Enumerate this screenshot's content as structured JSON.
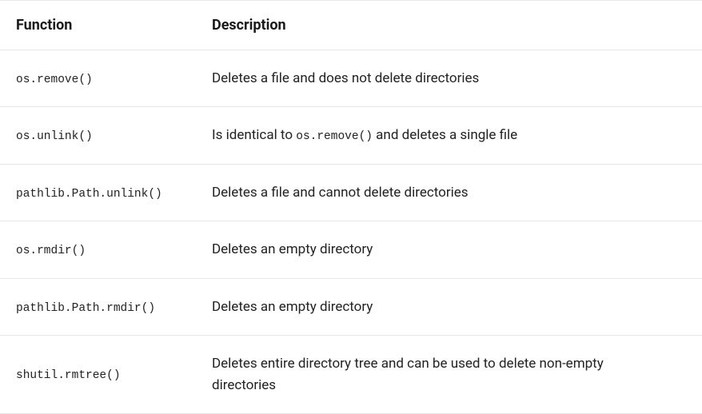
{
  "table": {
    "headers": {
      "function": "Function",
      "description": "Description"
    },
    "rows": [
      {
        "func": "os.remove()",
        "desc_before": "Deletes a file and does not delete directories",
        "desc_code": "",
        "desc_after": ""
      },
      {
        "func": "os.unlink()",
        "desc_before": "Is identical to ",
        "desc_code": "os.remove()",
        "desc_after": " and deletes a single file"
      },
      {
        "func": "pathlib.Path.unlink()",
        "desc_before": "Deletes a file and cannot delete directories",
        "desc_code": "",
        "desc_after": ""
      },
      {
        "func": "os.rmdir()",
        "desc_before": "Deletes an empty directory",
        "desc_code": "",
        "desc_after": ""
      },
      {
        "func": "pathlib.Path.rmdir()",
        "desc_before": "Deletes an empty directory",
        "desc_code": "",
        "desc_after": ""
      },
      {
        "func": "shutil.rmtree()",
        "desc_before": "Deletes entire directory tree and can be used to delete non-empty directories",
        "desc_code": "",
        "desc_after": ""
      }
    ]
  }
}
